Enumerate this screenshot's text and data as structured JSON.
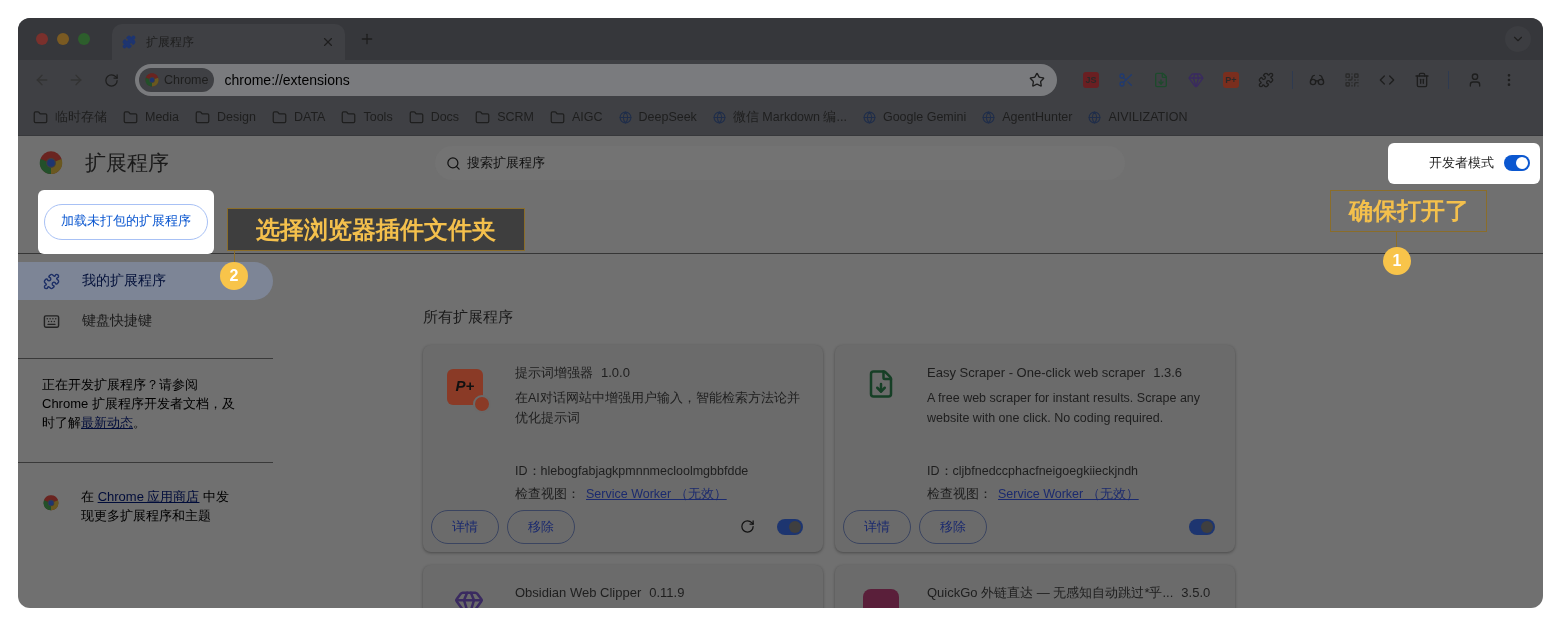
{
  "tab": {
    "title": "扩展程序"
  },
  "omnibox": {
    "chip": "Chrome",
    "url": "chrome://extensions"
  },
  "toolbar_extensions": [
    {
      "kind": "badge",
      "text": "JS",
      "color": "#6a1f22"
    },
    {
      "kind": "scissors"
    },
    {
      "kind": "sheet"
    },
    {
      "kind": "gem"
    },
    {
      "kind": "badge",
      "text": "P+",
      "color": "#7a2e1e"
    },
    {
      "kind": "puzzle"
    }
  ],
  "bookmarks": [
    {
      "kind": "folder",
      "label": "临时存储"
    },
    {
      "kind": "folder",
      "label": "Media"
    },
    {
      "kind": "folder",
      "label": "Design"
    },
    {
      "kind": "folder",
      "label": "DATA"
    },
    {
      "kind": "folder",
      "label": "Tools"
    },
    {
      "kind": "folder",
      "label": "Docs"
    },
    {
      "kind": "folder",
      "label": "SCRM"
    },
    {
      "kind": "folder",
      "label": "AIGC"
    },
    {
      "kind": "site",
      "label": "DeepSeek"
    },
    {
      "kind": "site",
      "label": "微信 Markdown 编..."
    },
    {
      "kind": "site",
      "label": "Google Gemini"
    },
    {
      "kind": "site",
      "label": "AgentHunter"
    },
    {
      "kind": "site",
      "label": "AIVILIZATION"
    }
  ],
  "page": {
    "title": "扩展程序",
    "search": {
      "placeholder": "搜索扩展程序"
    },
    "dev_mode": {
      "label": "开发者模式",
      "on": true
    },
    "load_unpacked": "加载未打包的扩展程序"
  },
  "sidebar": {
    "items": [
      {
        "kind": "extensions",
        "label": "我的扩展程序",
        "selected": true
      },
      {
        "kind": "keyboard",
        "label": "键盘快捷键",
        "selected": false
      }
    ],
    "dev_note": {
      "before": "正在开发扩展程序？请参阅Chrome 扩展程序开发者文档，及时了解",
      "link": "最新动态",
      "after": "。"
    },
    "store_note": {
      "before": "在 ",
      "link": "Chrome 应用商店",
      "after": " 中发现更多扩展程序和主题"
    }
  },
  "section_title": "所有扩展程序",
  "extensions": [
    {
      "icon_text": "P+",
      "name": "提示词增强器",
      "version": "1.0.0",
      "description": "在AI对话网站中增强用户输入，智能检索方法论并优化提示词",
      "id": "ID：hlebogfabjagkpmnnmecloolmgbbfdde",
      "inspect_label": "检查视图：",
      "inspect_link": "Service Worker （无效）",
      "buttons": [
        "详情",
        "移除"
      ],
      "reload": true,
      "enabled": true
    },
    {
      "name": "Easy Scraper - One-click web scraper",
      "version": "1.3.6",
      "description": "A free web scraper for instant results. Scrape any website with one click. No coding required.",
      "id": "ID：cljbfnedccphacfneigoegkiieckjndh",
      "inspect_label": "检查视图：",
      "inspect_link": "Service Worker （无效）",
      "buttons": [
        "详情",
        "移除"
      ],
      "reload": false,
      "enabled": true
    },
    {
      "name": "Obsidian Web Clipper",
      "version": "0.11.9"
    },
    {
      "name": "QuickGo 外链直达 — 无感知自动跳过*乎...",
      "version": "3.5.0"
    }
  ],
  "annotations": [
    {
      "number": "1",
      "text": "确保打开了"
    },
    {
      "number": "2",
      "text": "选择浏览器插件文件夹"
    }
  ]
}
